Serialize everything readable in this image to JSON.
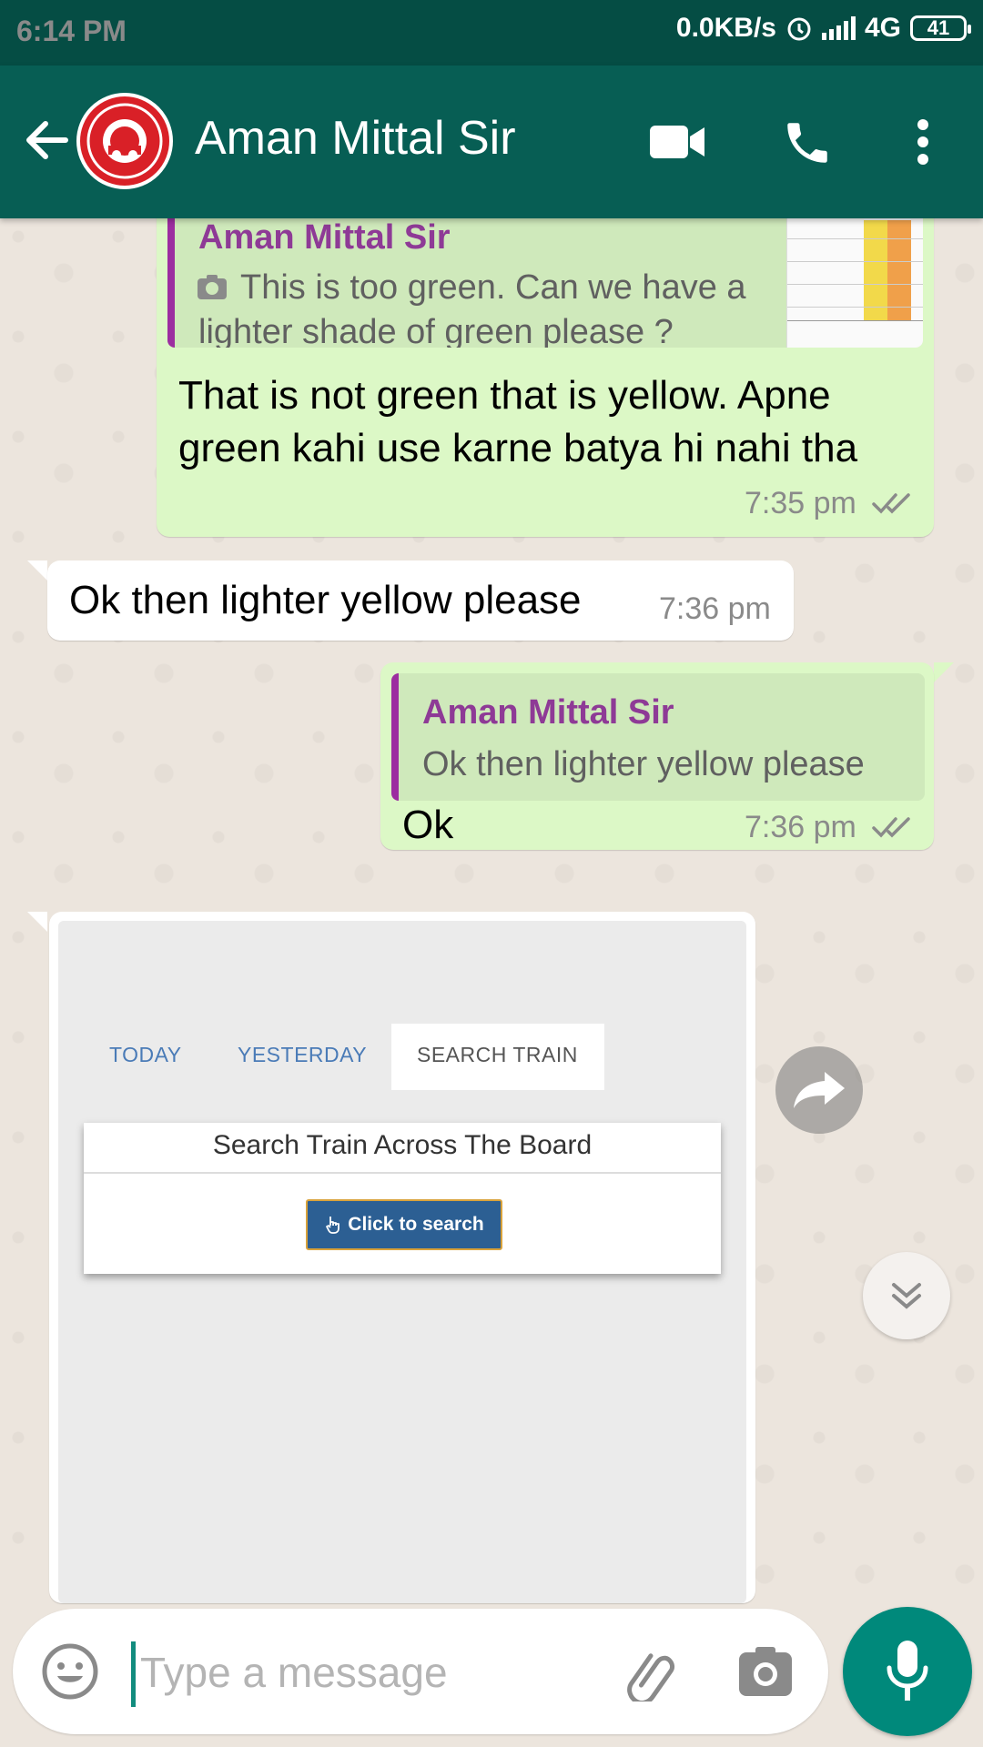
{
  "status_bar": {
    "time": "6:14 PM",
    "speed": "0.0KB/s",
    "network": "4G",
    "battery": "41"
  },
  "header": {
    "contact_name": "Aman Mittal Sir"
  },
  "messages": [
    {
      "direction": "outgoing",
      "quote": {
        "name": "Aman Mittal Sir",
        "text": "This is too green. Can we have a lighter shade of green please ?"
      },
      "text": "That is not green that is yellow. Apne green kahi use karne batya hi nahi tha",
      "time": "7:35 pm"
    },
    {
      "direction": "incoming",
      "text": "Ok then lighter yellow please",
      "time": "7:36 pm"
    },
    {
      "direction": "outgoing",
      "quote": {
        "name": "Aman Mittal Sir",
        "text": "Ok then lighter yellow please"
      },
      "text": "Ok",
      "time": "7:36 pm"
    },
    {
      "direction": "incoming",
      "image": {
        "tabs": [
          "TODAY",
          "YESTERDAY",
          "SEARCH TRAIN"
        ],
        "active_tab": "SEARCH TRAIN",
        "card_title": "Search Train Across The Board",
        "button_label": "Click to search"
      }
    }
  ],
  "input": {
    "placeholder": "Type a message"
  },
  "colors": {
    "header": "#075e54",
    "status_bar": "#054d44",
    "outgoing_bubble": "#dcf8c6",
    "accent": "#00897b",
    "quote_name": "#8e3a96"
  }
}
